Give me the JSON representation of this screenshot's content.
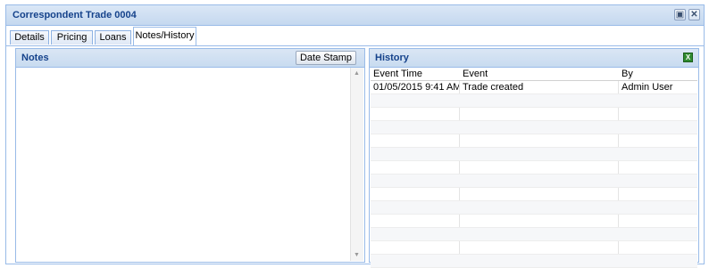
{
  "window": {
    "title": "Correspondent Trade 0004"
  },
  "tabs": [
    {
      "label": "Details"
    },
    {
      "label": "Pricing"
    },
    {
      "label": "Loans"
    },
    {
      "label": "Notes/History"
    }
  ],
  "notes": {
    "title": "Notes",
    "date_stamp_label": "Date Stamp",
    "text": ""
  },
  "history": {
    "title": "History",
    "columns": [
      "Event Time",
      "Event",
      "By"
    ],
    "rows": [
      [
        "01/05/2015 9:41 AM",
        "Trade created",
        "Admin User"
      ]
    ]
  }
}
